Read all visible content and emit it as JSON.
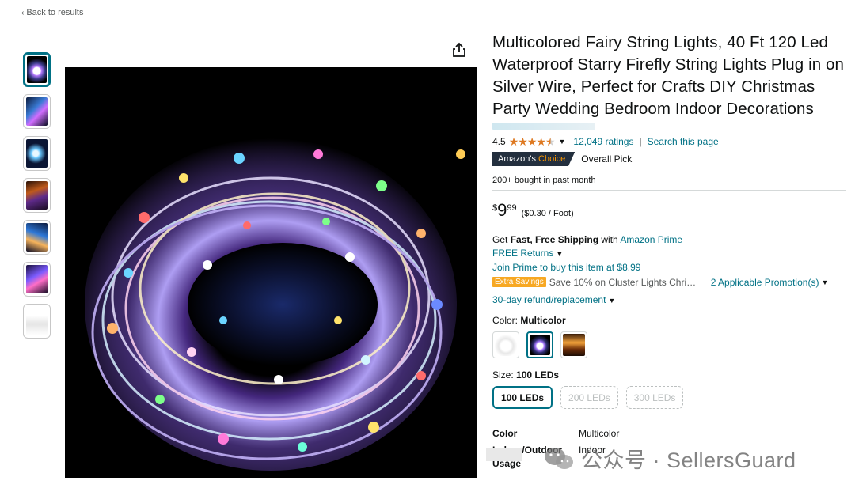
{
  "nav": {
    "back_label": "Back to results"
  },
  "gallery": {
    "thumbnails": [
      "thumb-1",
      "thumb-2",
      "thumb-3",
      "thumb-4",
      "thumb-5",
      "thumb-6",
      "thumb-7"
    ],
    "selected_index": 0
  },
  "product": {
    "title": "Multicolored Fairy String Lights, 40 Ft 120 Led Waterproof Starry Firefly String Lights Plug in on Silver Wire, Perfect for Crafts DIY Christmas Party Wedding Bedroom Indoor Decorations",
    "rating": "4.5",
    "stars": 4.5,
    "ratings_count": "12,049 ratings",
    "search_link": "Search this page",
    "badge_prefix": "Amazon's ",
    "badge_choice": "Choice",
    "badge_label": "Overall Pick",
    "bought": "200+ bought in past month"
  },
  "price": {
    "symbol": "$",
    "whole": "9",
    "fraction": "99",
    "unit": "($0.30 / Foot)"
  },
  "shipping": {
    "prefix": "Get ",
    "bold": "Fast, Free Shipping",
    "mid": " with ",
    "prime_link": "Amazon Prime",
    "returns": "FREE Returns",
    "join_prime": "Join Prime to buy this item at $8.99",
    "extra_badge": "Extra Savings",
    "promo_text": "Save 10% on Cluster Lights Chris…",
    "promo_link": "2 Applicable Promotion(s)",
    "refund": "30-day refund/replacement"
  },
  "color": {
    "label": "Color: ",
    "value": "Multicolor"
  },
  "size": {
    "label": "Size: ",
    "value": "100 LEDs",
    "options": [
      {
        "label": "100 LEDs",
        "available": true
      },
      {
        "label": "200 LEDs",
        "available": false
      },
      {
        "label": "300 LEDs",
        "available": false
      }
    ]
  },
  "specs": [
    {
      "key": "Color",
      "value": "Multicolor"
    },
    {
      "key": "Indoor/Outdoor Usage",
      "value": "Indoor"
    }
  ],
  "watermark": {
    "text": "公众号 · SellersGuard"
  },
  "colors": {
    "link": "#007185",
    "star": "#de7921",
    "badge_bg": "#232f3e",
    "badge_orange": "#ff9900",
    "extra": "#f7a823"
  }
}
